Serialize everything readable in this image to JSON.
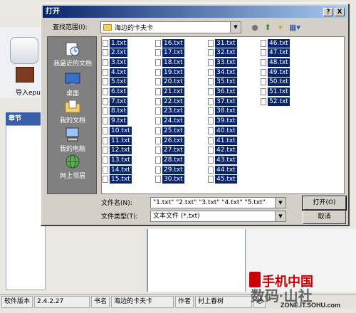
{
  "background_app": {
    "import_label": "导入epub",
    "chapter_label": "章节",
    "status": {
      "version_label": "软件版本",
      "version_value": "2.4.2.27",
      "book_label": "书名",
      "book_value": "海边的卡夫卡",
      "author_label": "作者",
      "author_value": "村上春树",
      "total_label": "总"
    }
  },
  "watermark": {
    "line1": "手机中国",
    "line2": "数码·山社",
    "line3": "ZONE.IT.SOHU.com"
  },
  "dialog": {
    "title": "打开",
    "help_btn": "?",
    "close_btn": "X",
    "look_in_label": "查找范围(I):",
    "look_in_value": "海边的卡夫卡",
    "places": [
      {
        "label": "我最近的文档",
        "icon": "recent-docs-icon"
      },
      {
        "label": "桌面",
        "icon": "desktop-icon"
      },
      {
        "label": "我的文档",
        "icon": "my-documents-icon"
      },
      {
        "label": "我的电脑",
        "icon": "my-computer-icon"
      },
      {
        "label": "网上邻居",
        "icon": "network-icon"
      }
    ],
    "files": [
      "1.txt",
      "2.txt",
      "3.txt",
      "4.txt",
      "5.txt",
      "6.txt",
      "7.txt",
      "8.txt",
      "9.txt",
      "10.txt",
      "11.txt",
      "12.txt",
      "13.txt",
      "14.txt",
      "15.txt",
      "16.txt",
      "17.txt",
      "18.txt",
      "19.txt",
      "20.txt",
      "21.txt",
      "22.txt",
      "23.txt",
      "24.txt",
      "25.txt",
      "26.txt",
      "27.txt",
      "28.txt",
      "29.txt",
      "30.txt",
      "31.txt",
      "32.txt",
      "33.txt",
      "34.txt",
      "35.txt",
      "36.txt",
      "37.txt",
      "38.txt",
      "39.txt",
      "40.txt",
      "41.txt",
      "42.txt",
      "43.txt",
      "44.txt",
      "45.txt",
      "46.txt",
      "47.txt",
      "48.txt",
      "49.txt",
      "50.txt",
      "51.txt",
      "52.txt"
    ],
    "filename_label": "文件名(N):",
    "filename_value": "\"1.txt\" \"2.txt\" \"3.txt\" \"4.txt\" \"5.txt\"",
    "filetype_label": "文件类型(T):",
    "filetype_value": "文本文件 (*.txt)",
    "open_btn": "打开(O)",
    "cancel_btn": "取消"
  }
}
